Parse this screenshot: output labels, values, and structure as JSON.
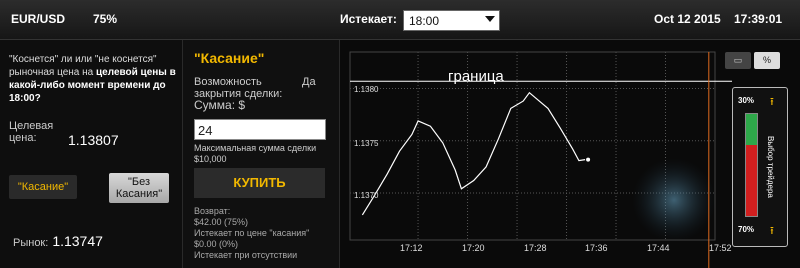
{
  "header": {
    "pair": "EUR/USD",
    "payout": "75%",
    "expires_label": "Истекает:",
    "expiry_value": "18:00",
    "date": "Oct 12 2015",
    "time": "17:39:01"
  },
  "left": {
    "desc_pre": "\"Коснется\" ли или \"не коснется\" рыночная цена на ",
    "desc_bold": "целевой цены в какой-либо момент времени до 18:00?",
    "strike_label_1": "Целевая",
    "strike_label_2": "цена:",
    "strike_value": "1.13807",
    "touch_label": "\"Касание\"",
    "no_touch_line1": "\"Без",
    "no_touch_line2": "Касания\"",
    "market_label": "Рынок:",
    "market_value": "1.13747"
  },
  "order": {
    "title": "\"Касание\"",
    "possible_1": "Возможность",
    "possible_2": "закрытия сделки:",
    "possible_value": "Да",
    "sum_label": "Сумма:  $",
    "amount": "24",
    "max_label": "Максимальная сумма сделки",
    "max_value": "$10,000",
    "buy_label": "КУПИТЬ",
    "return_label": "Возврат:",
    "return_value": "$42.00 (75%)",
    "return_note": "Истекает по цене \"касания\"",
    "return_zero": "$0.00 (0%)",
    "return_note2": "Истекает при отсутствии"
  },
  "chart_buttons": {
    "btn1": "▭",
    "btn2": "%"
  },
  "trader_choice": {
    "title": "Выбор трейдера",
    "up_pct": "30%",
    "down_pct": "70%",
    "up_share": 0.3,
    "down_share": 0.7,
    "up_color": "#2ea84a",
    "down_color": "#d11f1f",
    "arrow_icon": "up-arrow-icon"
  },
  "chart_data": {
    "type": "line",
    "annotation": "граница",
    "xticks": [
      "17:12",
      "17:20",
      "17:28",
      "17:36",
      "17:44",
      "17:52"
    ],
    "yticks": [
      "1.1380",
      "1.1375",
      "1.1370"
    ],
    "barrier": 1.13807,
    "expiry_marker": "18:00",
    "xlim_minutes": [
      1021,
      1080
    ],
    "ylim": [
      1.13655,
      1.13835
    ],
    "series": [
      {
        "x": [
          1023,
          1025,
          1027,
          1029,
          1031,
          1032,
          1034,
          1036,
          1038,
          1039,
          1041,
          1043,
          1045,
          1047,
          1049,
          1050,
          1052,
          1053,
          1055,
          1057,
          1058,
          1059
        ],
        "values": [
          1.13679,
          1.13698,
          1.13718,
          1.1374,
          1.13756,
          1.13769,
          1.13764,
          1.13748,
          1.13722,
          1.13704,
          1.13712,
          1.13725,
          1.13752,
          1.13781,
          1.13788,
          1.13796,
          1.13786,
          1.13781,
          1.13762,
          1.13742,
          1.13731,
          1.13732
        ]
      }
    ],
    "grid": true,
    "line_color": "#ffffff"
  }
}
